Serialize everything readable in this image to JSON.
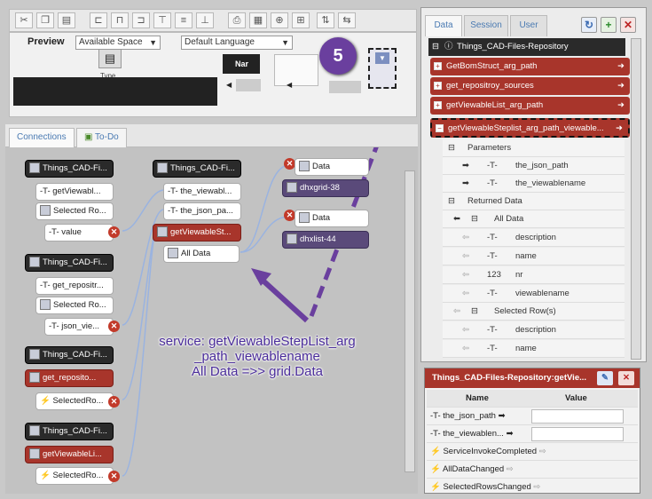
{
  "toolbar": {
    "icons": [
      "cut-icon",
      "copy-icon",
      "paste-icon",
      "align-left-icon",
      "align-center-icon",
      "align-right-icon",
      "align-top-icon",
      "align-middle-icon",
      "align-bottom-icon",
      "print-icon",
      "grid-icon",
      "target-icon",
      "layout-icon",
      "vertical-spacing-icon",
      "horizontal-spacing-icon"
    ]
  },
  "preview": {
    "label": "Preview",
    "space_select": "Available Space",
    "language_select": "Default Language",
    "type_label": "Type",
    "na_label": "Nar"
  },
  "left_tabs": {
    "connections": "Connections",
    "todo": "To-Do"
  },
  "canvas": {
    "col1": {
      "group1": {
        "title": "Things_CAD-Fi...",
        "item1": "getViewabl...",
        "item2": "Selected Ro...",
        "item3": "value"
      },
      "group2": {
        "title": "Things_CAD-Fi...",
        "item1": "get_repositr...",
        "item2": "Selected Ro...",
        "item3": "json_vie..."
      },
      "group3": {
        "title": "Things_CAD-Fi...",
        "item1": "get_reposito...",
        "item2": "SelectedRo..."
      },
      "group4": {
        "title": "Things_CAD-Fi...",
        "item1": "getViewableLi...",
        "item2": "SelectedRo..."
      }
    },
    "col2": {
      "title": "Things_CAD-Fi...",
      "item1": "the_viewabl...",
      "item2": "the_json_pa...",
      "item3": "getViewableSt...",
      "item4": "All Data"
    },
    "col3": {
      "data1": "Data",
      "grid": "dhxgrid-38",
      "data2": "Data",
      "list": "dhxlist-44"
    }
  },
  "right_panel": {
    "tabs": [
      "Data",
      "Session",
      "User"
    ],
    "root": "Things_CAD-Files-Repository",
    "services": [
      "GetBomStruct_arg_path",
      "get_repositroy_sources",
      "getViewableList_arg_path",
      "getViewableSteplist_arg_path_viewable..."
    ],
    "parameters_label": "Parameters",
    "params": [
      "the_json_path",
      "the_viewablename"
    ],
    "returned_label": "Returned Data",
    "all_data_label": "All Data",
    "all_data_fields": [
      "description",
      "name",
      "nr",
      "viewablename"
    ],
    "nr_type": "123",
    "selected_rows_label": "Selected Row(s)",
    "selected_fields": [
      "description",
      "name"
    ]
  },
  "props": {
    "title": "Things_CAD-Files-Repository:getVie...",
    "col_name": "Name",
    "col_value": "Value",
    "rows": [
      "the_json_path",
      "the_viewablen...",
      "ServiceInvokeCompleted",
      "AllDataChanged",
      "SelectedRowsChanged"
    ]
  },
  "annotation": {
    "step": "5",
    "line1": "service: getViewableStepList_arg",
    "line2": "_path_viewablename",
    "line3": "All Data =>> grid.Data"
  },
  "colors": {
    "service_red": "#a8352b",
    "annotation_purple": "#6a3f9e",
    "dark_node": "#2a2a2a"
  }
}
